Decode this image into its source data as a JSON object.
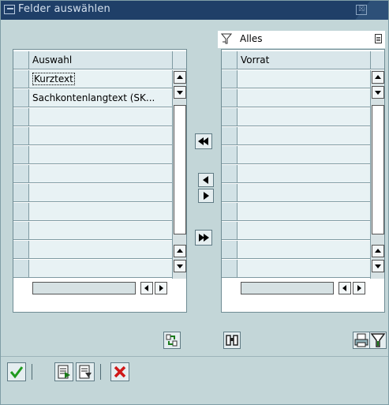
{
  "window": {
    "title": "Felder auswählen",
    "close_glyph": "☒"
  },
  "filter": {
    "value": "Alles",
    "icon": "filter-icon"
  },
  "left_table": {
    "header": "Auswahl",
    "rows": [
      "Kurztext",
      "Sachkontenlangtext (SK..."
    ],
    "focused_row": 0,
    "visible_rows": 11
  },
  "right_table": {
    "header": "Vorrat",
    "rows": [],
    "visible_rows": 11
  },
  "transfer_buttons": [
    {
      "name": "move-all-left-button",
      "icon": "double-arrow-left-icon"
    },
    {
      "name": "move-left-button",
      "icon": "arrow-left-icon"
    },
    {
      "name": "move-right-button",
      "icon": "arrow-right-icon"
    },
    {
      "name": "move-all-right-button",
      "icon": "double-arrow-right-icon"
    }
  ],
  "tools": {
    "left": {
      "icon": "sort-icon"
    },
    "middle": {
      "icon": "find-binoculars-icon"
    },
    "right": [
      {
        "icon": "print-icon"
      },
      {
        "icon": "filter-set-icon"
      }
    ]
  },
  "footer_buttons": [
    {
      "name": "confirm-button",
      "icon": "checkmark-icon",
      "color": "#1f9a1f"
    },
    {
      "name": "select-layout-button",
      "icon": "layout-list-icon"
    },
    {
      "name": "save-layout-button",
      "icon": "layout-save-icon"
    },
    {
      "name": "cancel-button",
      "icon": "cancel-x-icon",
      "color": "#d01818"
    }
  ],
  "colors": {
    "titlebar": "#2d5078",
    "background": "#c3d6d8",
    "row": "#e8f2f4"
  }
}
